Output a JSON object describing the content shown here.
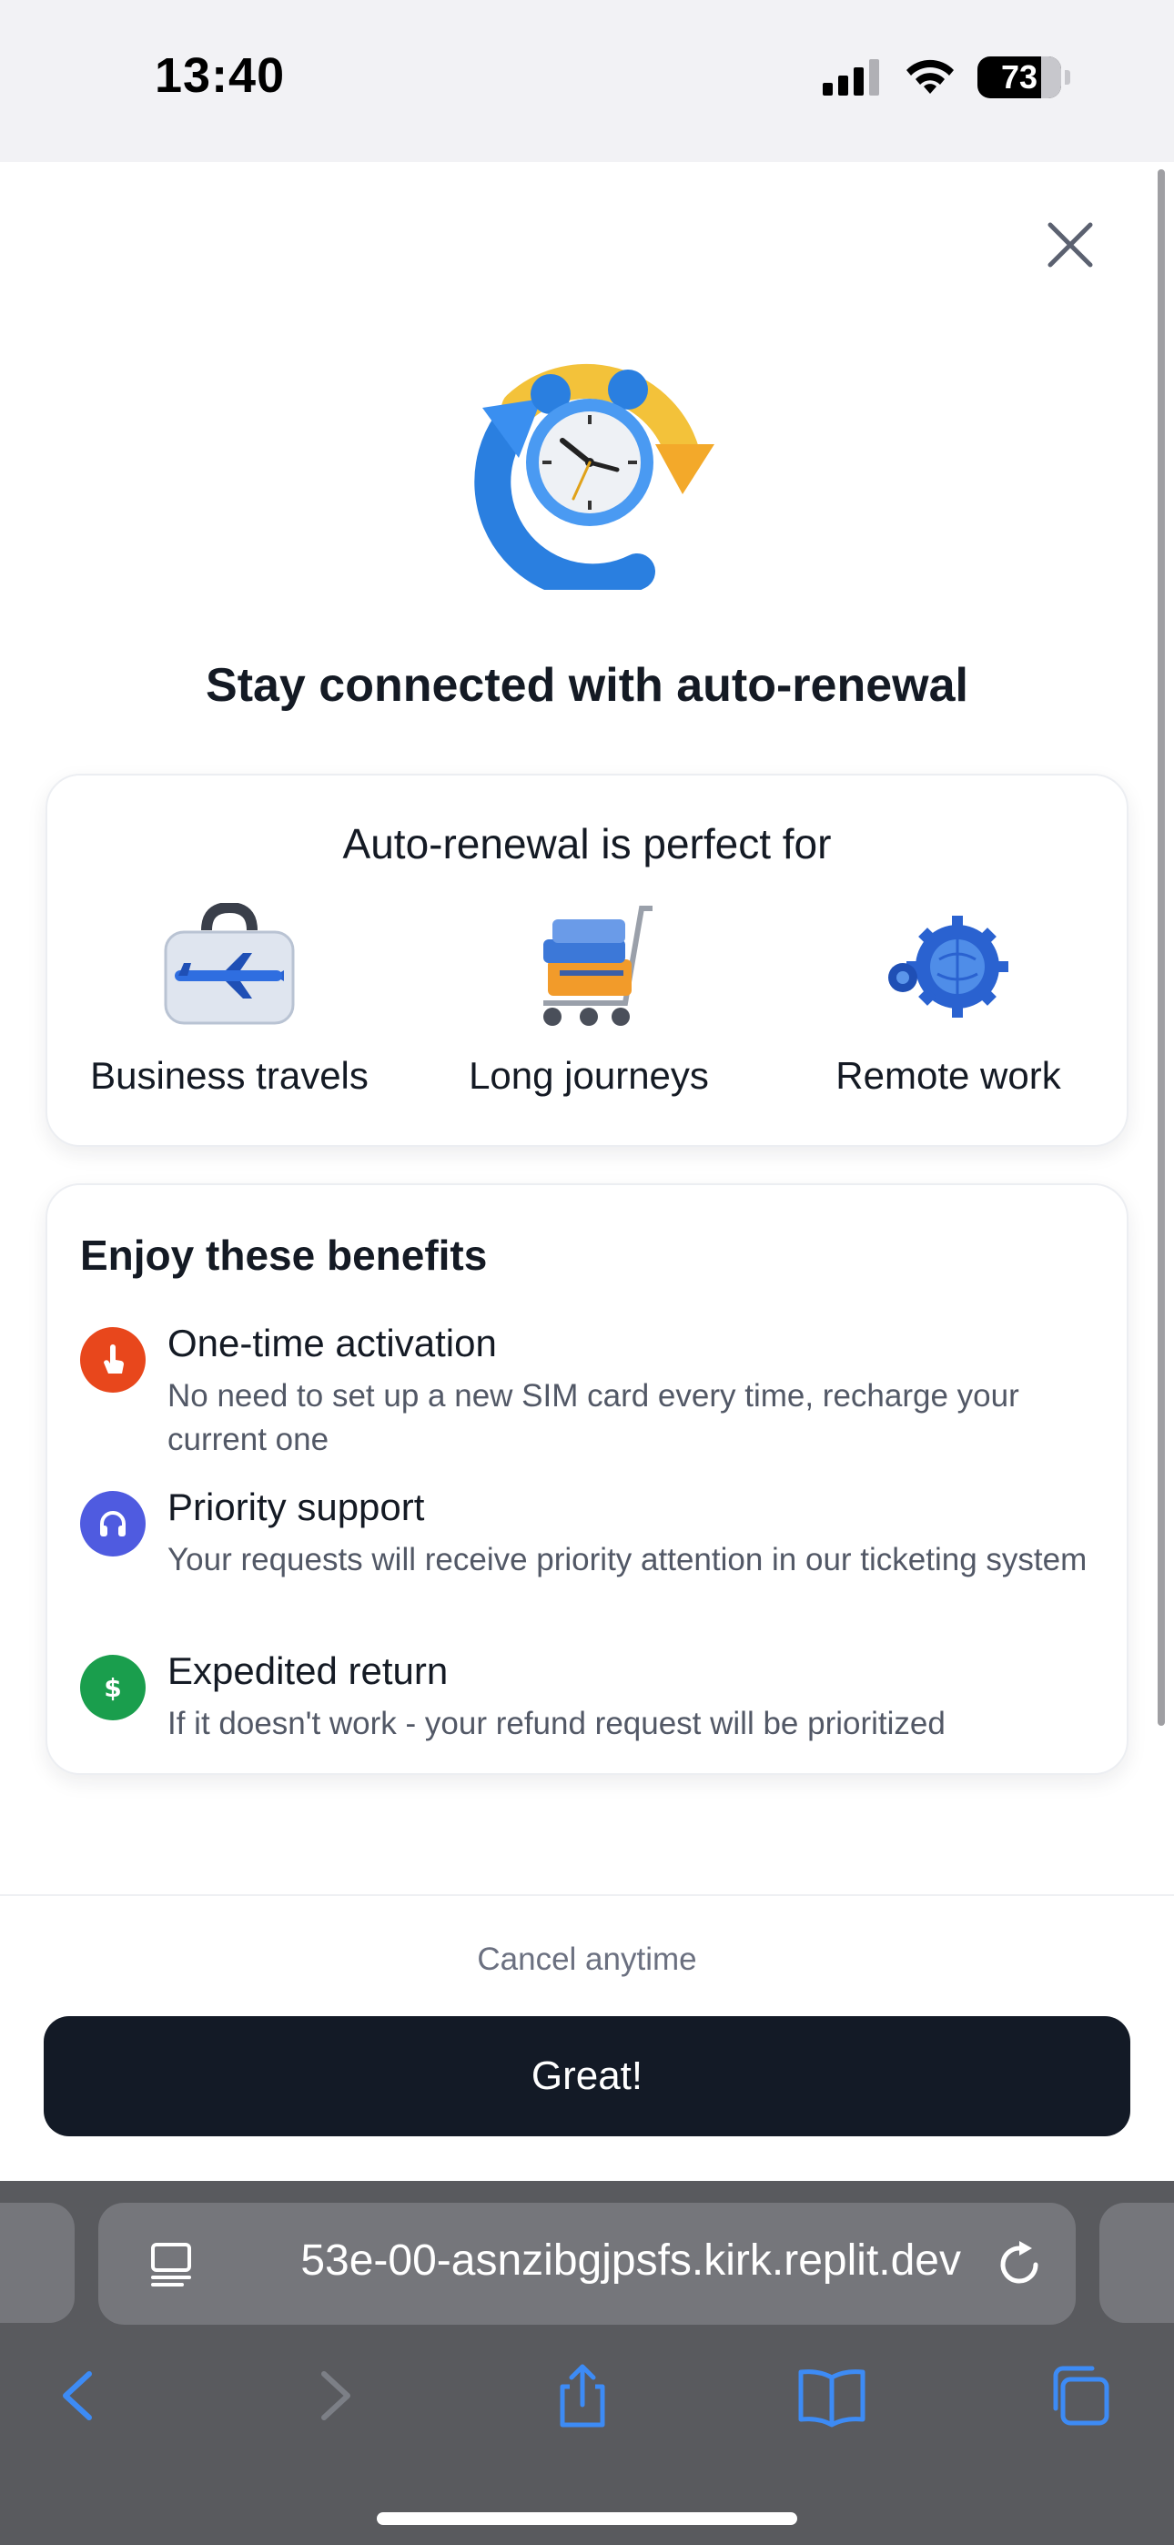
{
  "status_bar": {
    "time": "13:40",
    "battery_percent": "73"
  },
  "sheet": {
    "hero_icon": "auto-renew-alarm-clock-icon",
    "title": "Stay connected with auto-renewal",
    "use_cases": {
      "title": "Auto-renewal is perfect for",
      "items": [
        {
          "label": "Business travels",
          "icon": "briefcase-plane-icon"
        },
        {
          "label": "Long journeys",
          "icon": "luggage-cart-icon"
        },
        {
          "label": "Remote work",
          "icon": "globe-gear-icon"
        }
      ]
    },
    "benefits": {
      "title": "Enjoy these benefits",
      "items": [
        {
          "title": "One-time activation",
          "description": "No need to set up a new SIM card every time, recharge your current one",
          "icon": "touch-icon",
          "color": "#e8471c"
        },
        {
          "title": "Priority support",
          "description": "Your requests will receive priority attention in our ticketing system",
          "icon": "headphones-icon",
          "color": "#4f5be0"
        },
        {
          "title": "Expedited return",
          "description": "If it doesn't work - your refund request will be prioritized",
          "icon": "dollar-icon",
          "color": "#1a9e4d"
        }
      ]
    },
    "footer_note": "Cancel anytime",
    "cta_label": "Great!"
  },
  "browser": {
    "url": "53e-00-asnzibgjpsfs.kirk.replit.dev",
    "accent": "#3d8bf5"
  }
}
